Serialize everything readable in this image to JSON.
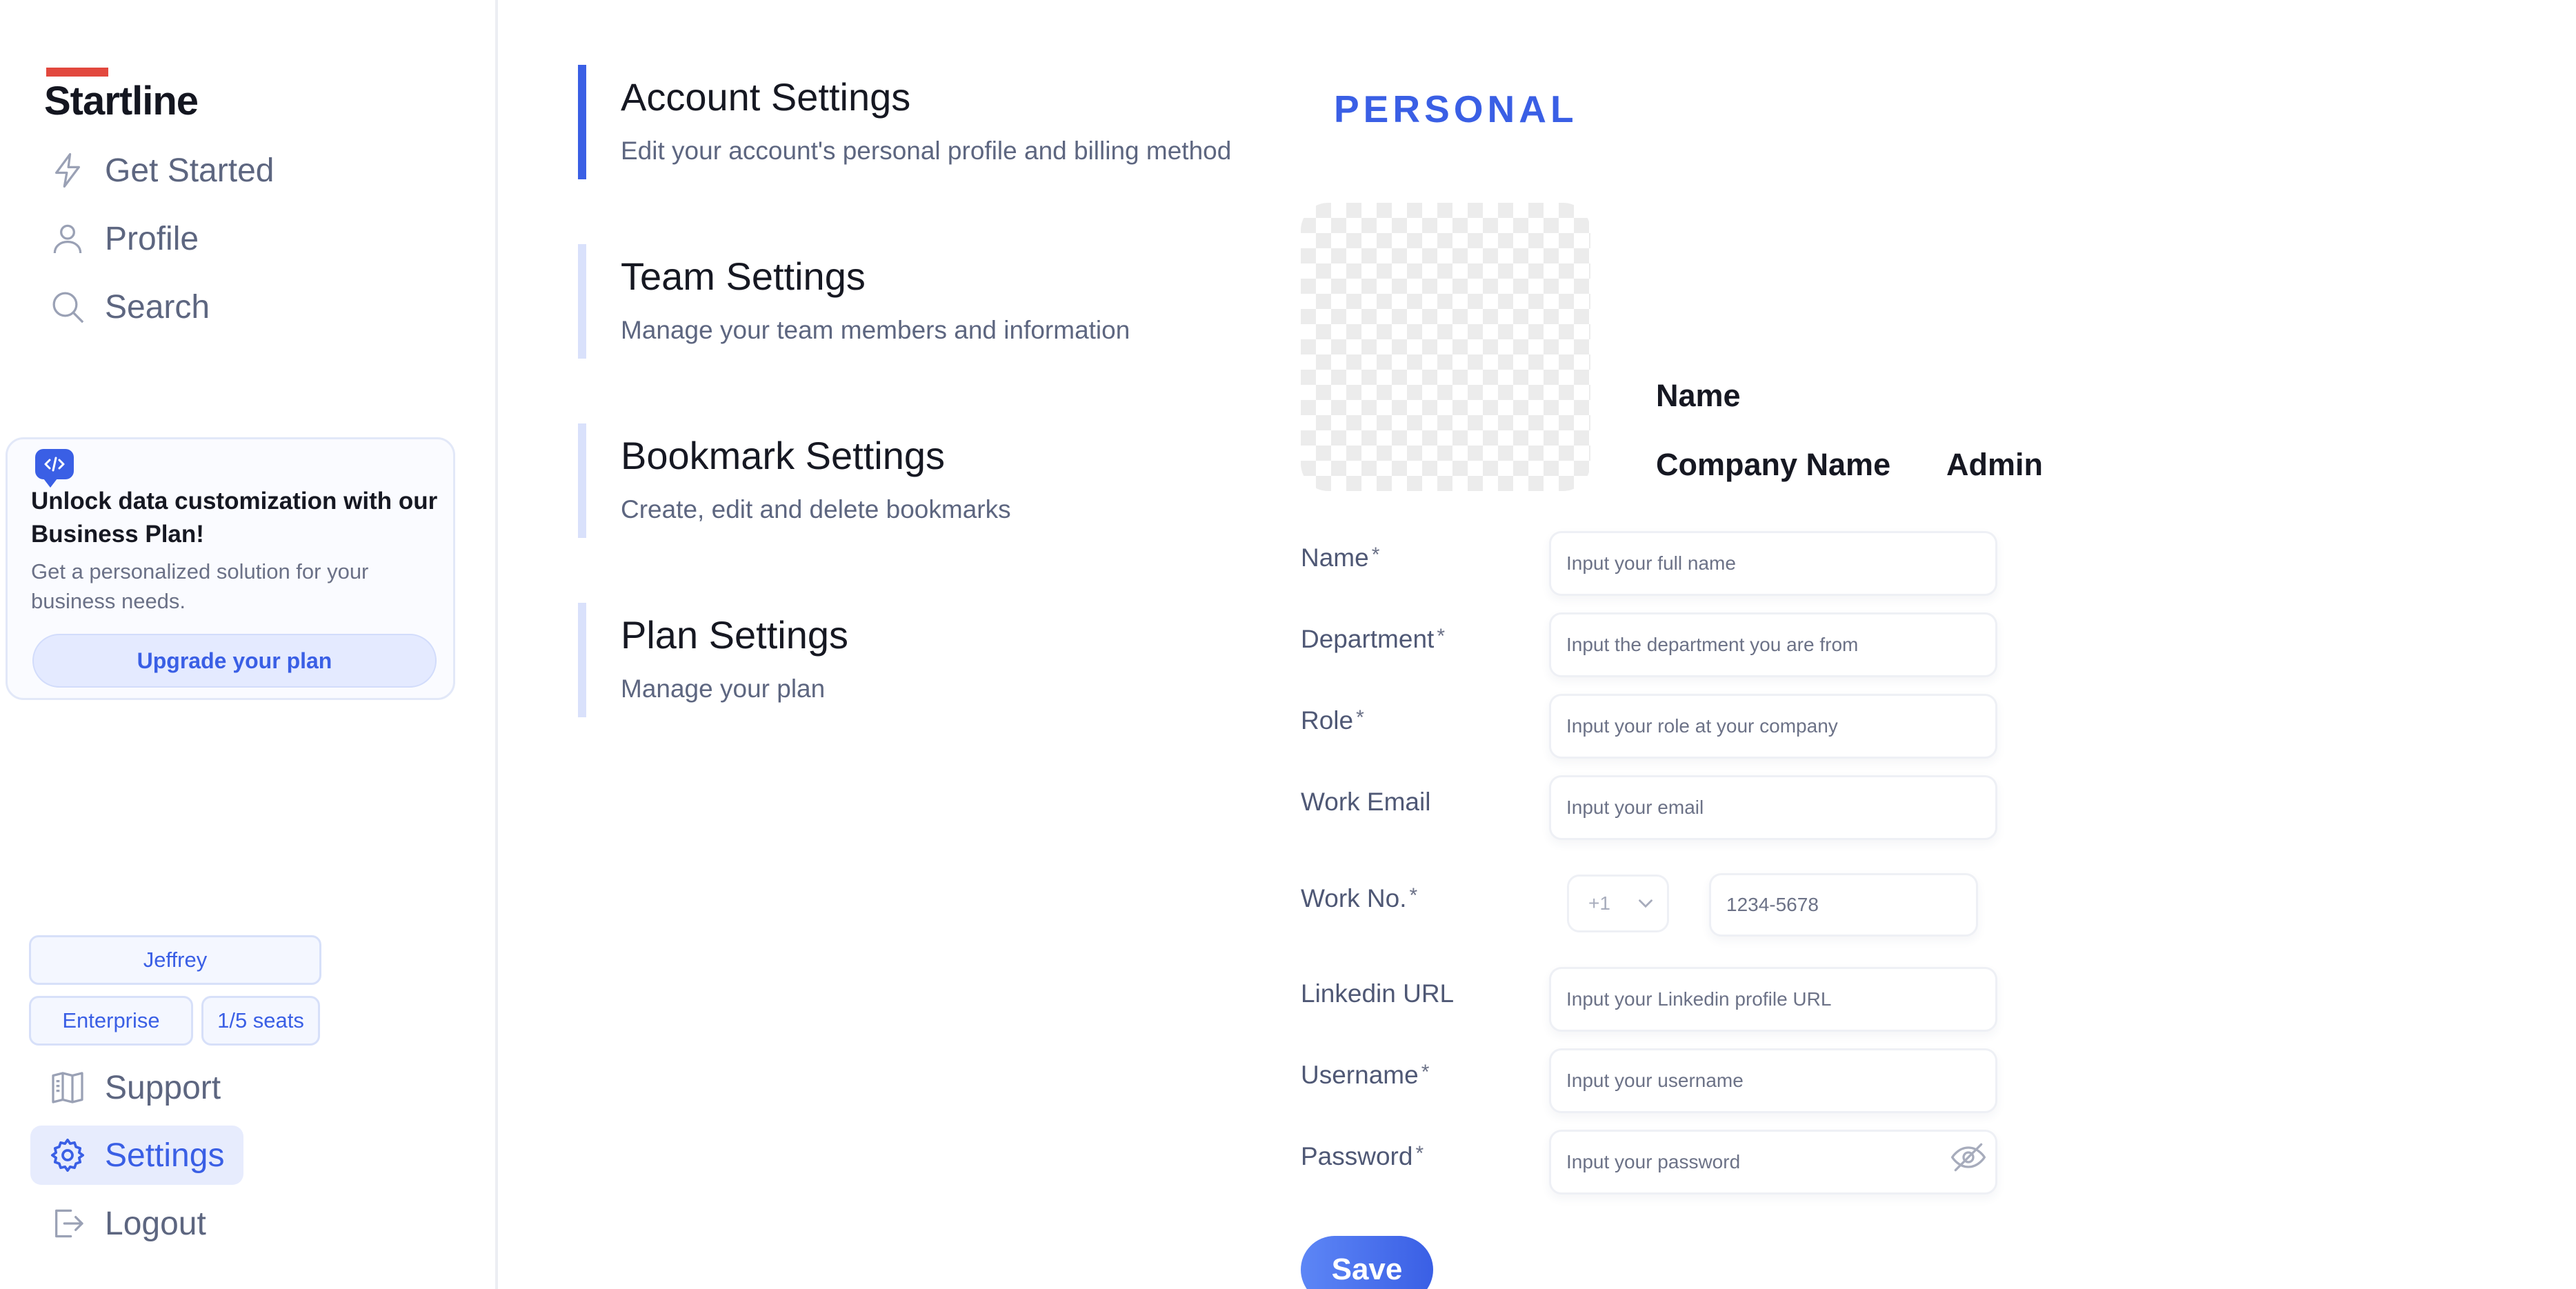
{
  "brand": {
    "name": "Startline",
    "accent_color": "#e2483e"
  },
  "sidebar": {
    "nav_items": [
      {
        "label": "Get Started",
        "icon": "lightning-icon"
      },
      {
        "label": "Profile",
        "icon": "user-icon"
      },
      {
        "label": "Search",
        "icon": "search-icon"
      }
    ],
    "promo": {
      "icon": "code-chat-icon",
      "title": "Unlock data customization with our Business Plan!",
      "text": "Get a personalized solution for your business needs.",
      "button_label": "Upgrade your plan"
    },
    "user": {
      "name": "Jeffrey",
      "plan": "Enterprise",
      "seats": "1/5 seats"
    },
    "bottom_items": [
      {
        "label": "Support",
        "icon": "book-icon",
        "active": false
      },
      {
        "label": "Settings",
        "icon": "gear-icon",
        "active": true
      },
      {
        "label": "Logout",
        "icon": "logout-icon",
        "active": false
      }
    ]
  },
  "settings_menu": [
    {
      "title": "Account Settings",
      "description": "Edit your account's personal profile and billing method",
      "active": true
    },
    {
      "title": "Team Settings",
      "description": "Manage your team members and information",
      "active": false
    },
    {
      "title": "Bookmark Settings",
      "description": "Create, edit and delete bookmarks",
      "active": false
    },
    {
      "title": "Plan Settings",
      "description": "Manage your plan",
      "active": false
    }
  ],
  "personal": {
    "section_title": "PERSONAL",
    "profile": {
      "name": "Name",
      "company": "Company Name",
      "role": "Admin"
    },
    "fields": {
      "name": {
        "label": "Name",
        "required": "*",
        "placeholder": "Input your full name"
      },
      "department": {
        "label": "Department",
        "required": "*",
        "placeholder": "Input the department you are from"
      },
      "role": {
        "label": "Role",
        "required": "*",
        "placeholder": "Input your role at your company"
      },
      "work_email": {
        "label": "Work Email",
        "placeholder": "Input your email"
      },
      "work_no": {
        "label": "Work No.",
        "required": "*",
        "country_code": "+1",
        "placeholder": "1234-5678"
      },
      "linkedin": {
        "label": "Linkedin URL",
        "placeholder": "Input your Linkedin profile URL"
      },
      "username": {
        "label": "Username",
        "required": "*",
        "placeholder": "Input your username"
      },
      "password": {
        "label": "Password",
        "required": "*",
        "placeholder": "Input your password",
        "toggle_icon": "eye-off-icon"
      }
    },
    "save_label": "Save"
  },
  "colors": {
    "primary": "#3a5fe5",
    "muted_text": "#5d6680",
    "active_bg": "#e7ecfd"
  }
}
